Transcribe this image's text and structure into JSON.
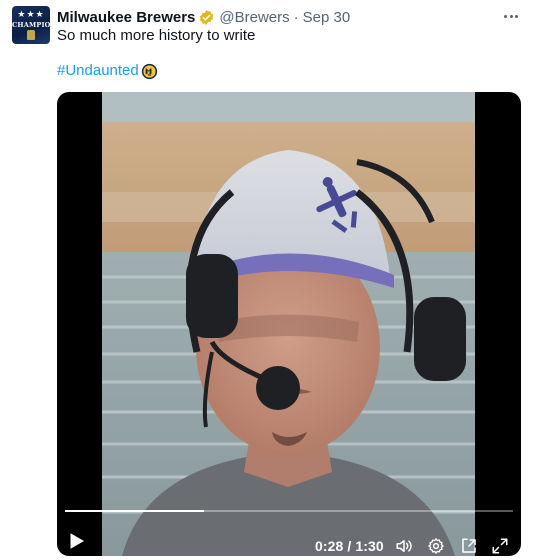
{
  "author": {
    "display_name": "Milwaukee Brewers",
    "handle": "@Brewers",
    "separator": "·",
    "date": "Sep 30",
    "avatar_text": "CHAMPIONS",
    "avatar_stars": "★★★",
    "verified_color": "#e2b719"
  },
  "tweet": {
    "text": "So much more history to write",
    "hashtag": "#Undaunted",
    "hashtag_color": "#1d9bf0"
  },
  "video": {
    "current_time": "0:28",
    "duration": "1:30",
    "time_display": "0:28 / 1:30",
    "progress": 0.31
  },
  "icons": {
    "more": "more-options-icon",
    "play": "play-icon",
    "volume": "volume-icon",
    "settings": "settings-gear-icon",
    "pip": "picture-in-picture-icon",
    "fullscreen": "fullscreen-icon",
    "emoji": "brewers-ball-glove-emoji"
  }
}
